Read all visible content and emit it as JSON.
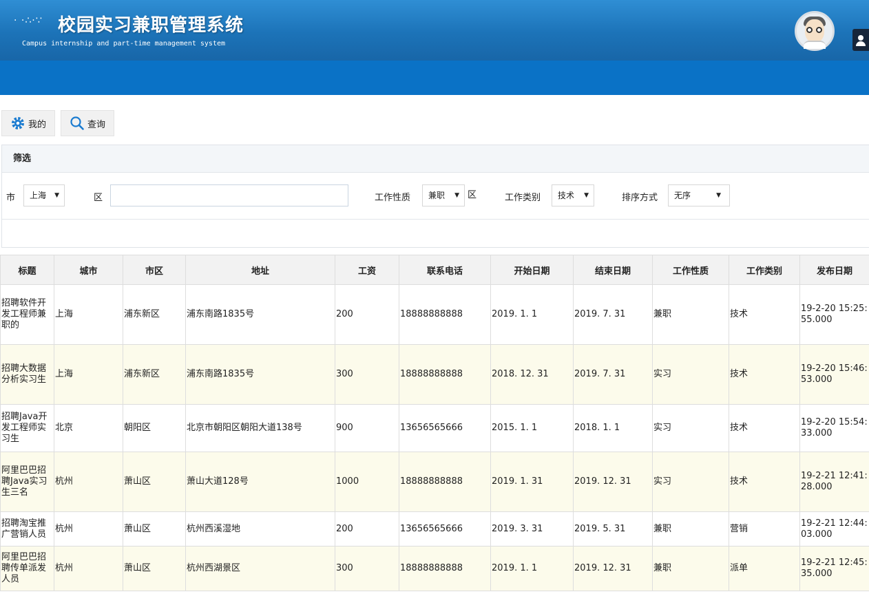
{
  "header": {
    "title": "校园实习兼职管理系统",
    "subtitle": "Campus internship and part-time management system",
    "colors": {
      "header_top": "#2f8ed4",
      "header_bottom": "#1866a8",
      "nav_bar": "#0a72c6"
    }
  },
  "toolbar": {
    "mine_label": "我的",
    "query_label": "查询"
  },
  "filter": {
    "title": "筛选",
    "city_label": "市",
    "city_value": "上海",
    "district_label": "区",
    "district_value": "",
    "nature_label": "工作性质",
    "nature_value": "兼职",
    "nature_suffix": "区",
    "category_label": "工作类别",
    "category_value": "技术",
    "sort_label": "排序方式",
    "sort_value": "无序"
  },
  "table": {
    "headers": [
      "标题",
      "城市",
      "市区",
      "地址",
      "工资",
      "联系电话",
      "开始日期",
      "结束日期",
      "工作性质",
      "工作类别",
      "发布日期"
    ],
    "rows": [
      [
        "招聘软件开发工程师兼职的",
        "上海",
        "浦东新区",
        "浦东南路1835号",
        "200",
        "18888888888",
        "2019. 1. 1",
        "2019. 7. 31",
        "兼职",
        "技术",
        "19-2-20 15:25:55.000"
      ],
      [
        "招聘大数据分析实习生",
        "上海",
        "浦东新区",
        "浦东南路1835号",
        "300",
        "18888888888",
        "2018. 12. 31",
        "2019. 7. 31",
        "实习",
        "技术",
        "19-2-20 15:46:53.000"
      ],
      [
        "招聘Java开发工程师实习生",
        "北京",
        "朝阳区",
        "北京市朝阳区朝阳大道138号",
        "900",
        "13656565666",
        "2015. 1. 1",
        "2018. 1. 1",
        "实习",
        "技术",
        "19-2-20 15:54:33.000"
      ],
      [
        "阿里巴巴招聘Java实习生三名",
        "杭州",
        "萧山区",
        "萧山大道128号",
        "1000",
        "18888888888",
        "2019. 1. 31",
        "2019. 12. 31",
        "实习",
        "技术",
        "19-2-21 12:41:28.000"
      ],
      [
        "招聘淘宝推广营销人员",
        "杭州",
        "萧山区",
        "杭州西溪湿地",
        "200",
        "13656565666",
        "2019. 3. 31",
        "2019. 5. 31",
        "兼职",
        "营销",
        "19-2-21 12:44:03.000"
      ],
      [
        "阿里巴巴招聘传单派发人员",
        "杭州",
        "萧山区",
        "杭州西湖景区",
        "300",
        "18888888888",
        "2019. 1. 1",
        "2019. 12. 31",
        "兼职",
        "派单",
        "19-2-21 12:45:35.000"
      ]
    ]
  },
  "icons": [
    "logo-dots-icon",
    "avatar-icon",
    "user-icon",
    "gear-icon",
    "search-icon",
    "dropdown-arrow-icon"
  ]
}
